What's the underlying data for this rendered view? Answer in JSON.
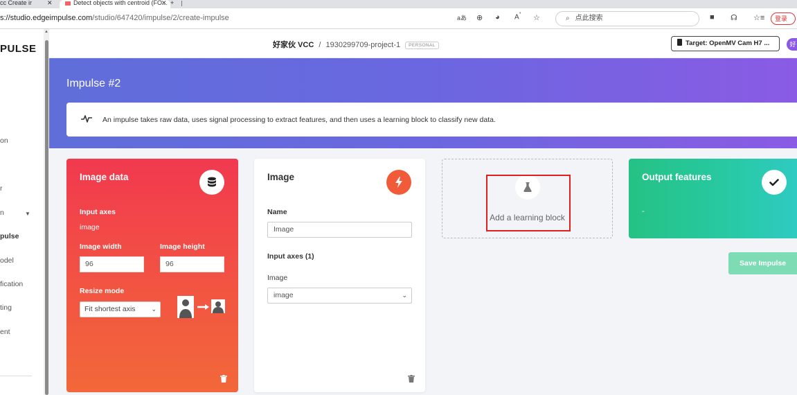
{
  "browser": {
    "tabs": [
      {
        "label": "cc   Create ir"
      },
      {
        "label": "Detect objects with centroid (FO..."
      }
    ],
    "url_host": "s://studio.edgeimpulse.com",
    "url_path": "/studio/647420/impulse/2/create-impulse",
    "search_placeholder": "点此搜索",
    "login_label": "登录"
  },
  "sidebar": {
    "brand": "PULSE",
    "items": [
      {
        "label": "on"
      },
      {
        "label": "r"
      },
      {
        "label": "n"
      },
      {
        "label": "pulse"
      },
      {
        "label": "odel"
      },
      {
        "label": "fication"
      },
      {
        "label": "ting"
      },
      {
        "label": "ent"
      }
    ]
  },
  "header": {
    "org": "好家伙 VCC",
    "separator": "/",
    "project": "1930299709-project-1",
    "badge": "PERSONAL",
    "target_label": "Target: OpenMV Cam H7 ...",
    "avatar_initial": "好"
  },
  "page": {
    "title": "Impulse #2",
    "info": "An impulse takes raw data, uses signal processing to extract features, and then uses a learning block to classify new data."
  },
  "input_block": {
    "title": "Image data",
    "input_axes_label": "Input axes",
    "input_axes_value": "image",
    "width_label": "Image width",
    "width_value": "96",
    "height_label": "Image height",
    "height_value": "96",
    "resize_label": "Resize mode",
    "resize_value": "Fit shortest axis"
  },
  "processing_block": {
    "title": "Image",
    "name_label": "Name",
    "name_value": "Image",
    "input_axes_label": "Input axes (1)",
    "axis_label": "Image",
    "axis_value": "image"
  },
  "learning_block": {
    "add_label": "Add a learning block"
  },
  "output_block": {
    "title": "Output features",
    "value": "-"
  },
  "actions": {
    "save_label": "Save Impulse"
  }
}
